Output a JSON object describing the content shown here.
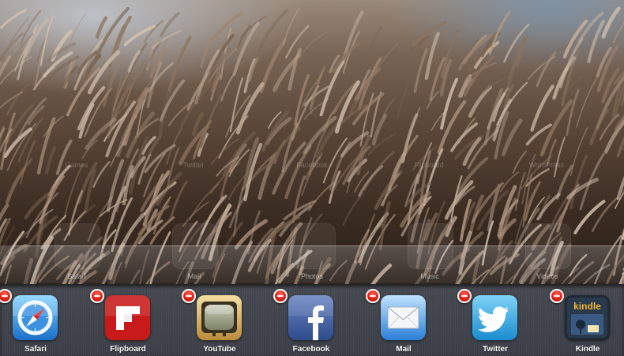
{
  "home_screen": {
    "row1_labels": [
      "Games",
      "Twitter",
      "Facebook",
      "Flipboard",
      "WordPress"
    ],
    "dock_apps": [
      {
        "label": "Safari"
      },
      {
        "label": "Mail"
      },
      {
        "label": "Photos"
      },
      {
        "label": "Music"
      },
      {
        "label": "Videos"
      }
    ]
  },
  "tray": {
    "apps": [
      {
        "label": "Safari",
        "icon": "safari-icon"
      },
      {
        "label": "Flipboard",
        "icon": "flipboard-icon"
      },
      {
        "label": "YouTube",
        "icon": "youtube-icon"
      },
      {
        "label": "Facebook",
        "icon": "facebook-icon"
      },
      {
        "label": "Mail",
        "icon": "mail-icon"
      },
      {
        "label": "Twitter",
        "icon": "twitter-icon"
      },
      {
        "label": "Kindle",
        "icon": "kindle-icon",
        "icon_text": "kindle"
      }
    ]
  },
  "colors": {
    "close_badge": "#d81e12",
    "tray_bg": "#474a52",
    "flipboard_red": "#c81a1a",
    "facebook_blue": "#3b5998",
    "twitter_blue": "#2a9fd8",
    "kindle_dark": "#1f2a36"
  }
}
